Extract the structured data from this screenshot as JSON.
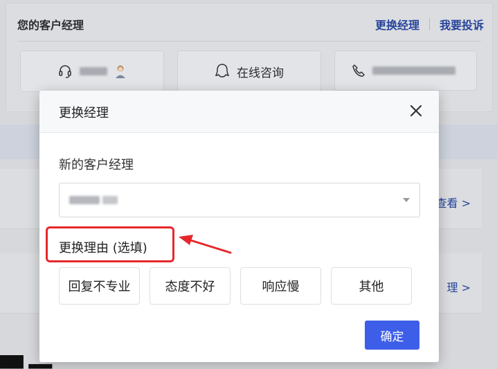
{
  "background": {
    "card_title": "您的客户经理",
    "links": {
      "change_manager": "更换经理",
      "complain": "我要投诉"
    },
    "tiles": {
      "consult": "在线咨询"
    },
    "row_links": [
      "查看 >",
      "理 >"
    ]
  },
  "modal": {
    "title": "更换经理",
    "field_label": "新的客户经理",
    "reason_label": "更换理由 (选填)",
    "reasons": [
      "回复不专业",
      "态度不好",
      "响应慢",
      "其他"
    ],
    "confirm_label": "确定"
  },
  "colors": {
    "accent": "#3d5ee8",
    "annotation": "#e5272b",
    "link": "#27449b"
  }
}
